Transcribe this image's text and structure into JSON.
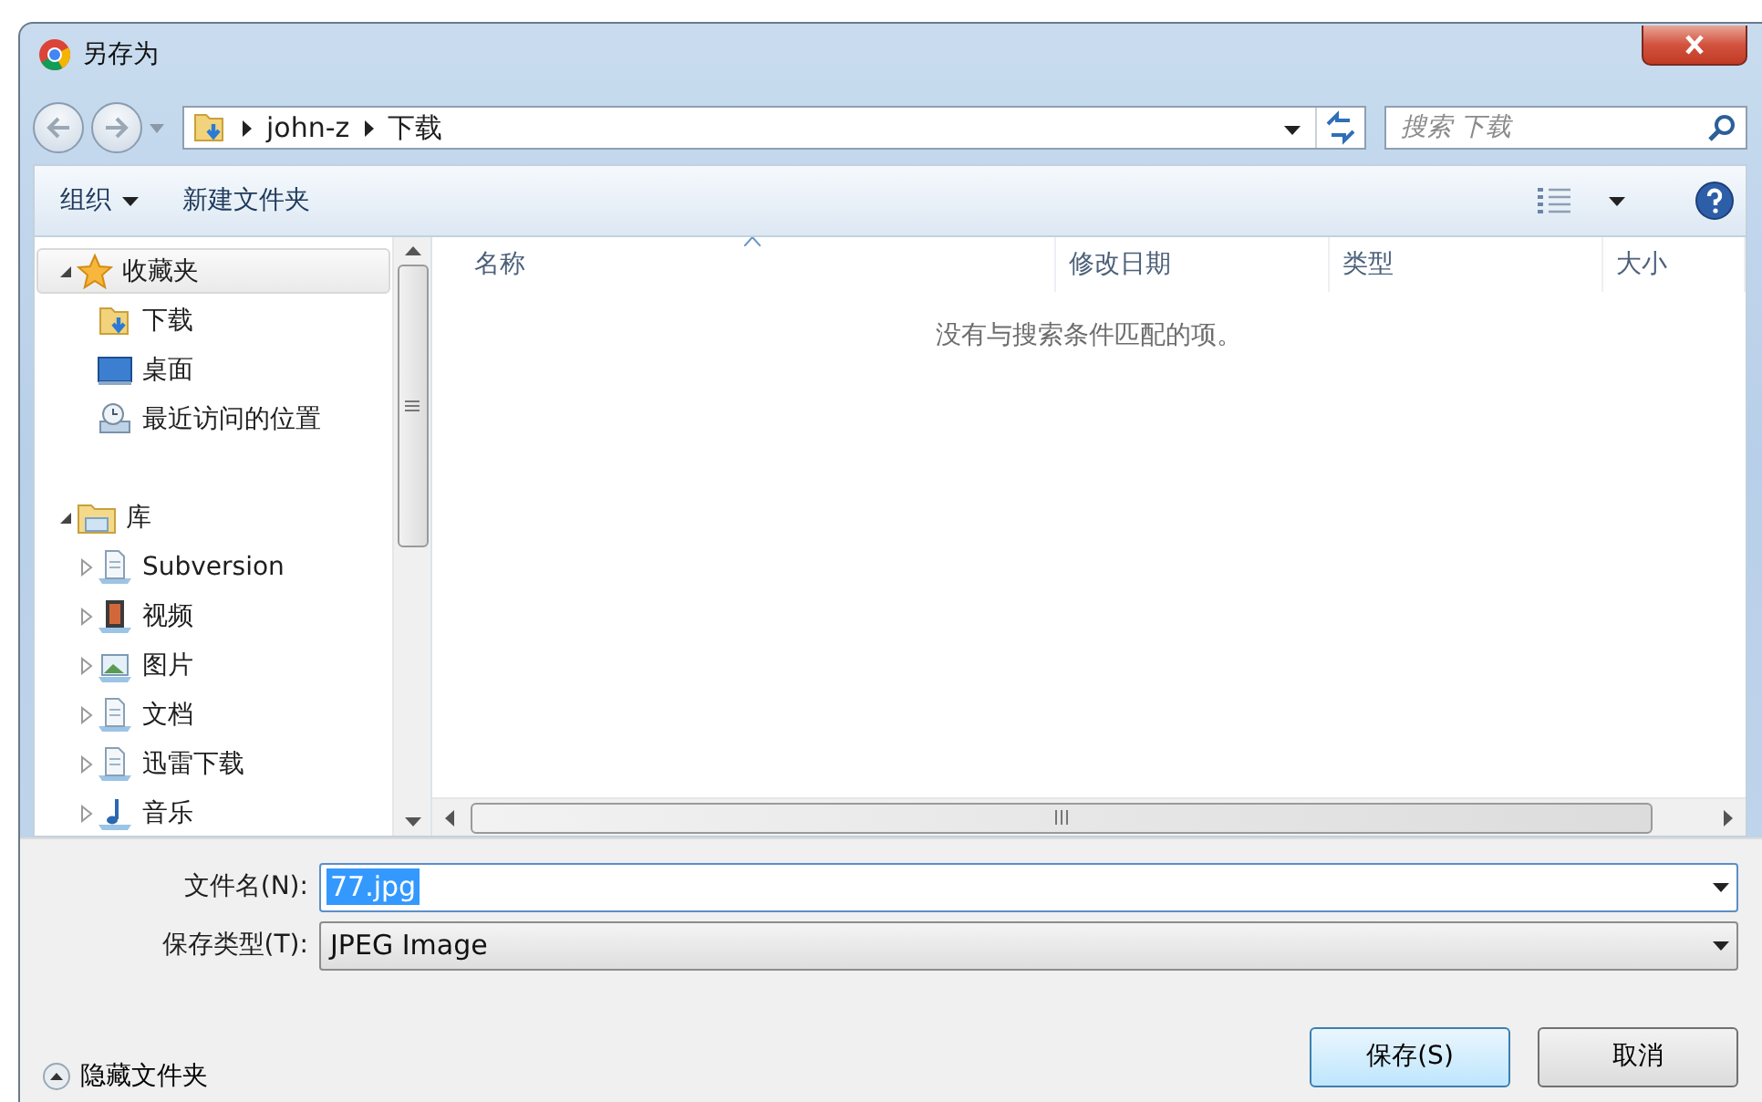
{
  "window": {
    "title": "另存为"
  },
  "address": {
    "path": [
      "john-z",
      "下载"
    ]
  },
  "search": {
    "placeholder": "搜索 下载"
  },
  "toolbar": {
    "items": [
      {
        "label": "组织",
        "dropdown": true
      },
      {
        "label": "新建文件夹",
        "dropdown": false
      }
    ]
  },
  "sidebar": {
    "items": [
      {
        "label": "收藏夹",
        "kind": "star",
        "expanded": true,
        "selected": true,
        "children": [
          {
            "label": "下载",
            "kind": "download",
            "selected": false
          },
          {
            "label": "桌面",
            "kind": "desktop",
            "selected": false
          },
          {
            "label": "最近访问的位置",
            "kind": "recent",
            "selected": false
          }
        ]
      },
      {
        "label": "库",
        "kind": "library",
        "expanded": true,
        "selected": false,
        "children": [
          {
            "label": "Subversion",
            "kind": "doclib",
            "expanded": false,
            "selected": false
          },
          {
            "label": "视频",
            "kind": "video",
            "expanded": false,
            "selected": false
          },
          {
            "label": "图片",
            "kind": "pictures",
            "expanded": false,
            "selected": false
          },
          {
            "label": "文档",
            "kind": "doclib",
            "expanded": false,
            "selected": false
          },
          {
            "label": "迅雷下载",
            "kind": "doclib",
            "expanded": false,
            "selected": false
          },
          {
            "label": "音乐",
            "kind": "music",
            "expanded": false,
            "selected": false
          }
        ]
      }
    ]
  },
  "file_list": {
    "columns": [
      {
        "label": "名称",
        "sorted": true
      },
      {
        "label": "修改日期",
        "sorted": false
      },
      {
        "label": "类型",
        "sorted": false
      },
      {
        "label": "大小",
        "sorted": false
      }
    ],
    "empty_message": "没有与搜索条件匹配的项。"
  },
  "form": {
    "fields": [
      {
        "label": "文件名(N):",
        "value": "77.jpg",
        "selected": true
      },
      {
        "label": "保存类型(T):",
        "value": "JPEG Image",
        "selected": false
      }
    ]
  },
  "hide_folders": {
    "label": "隐藏文件夹"
  },
  "buttons": [
    {
      "label": "保存(S)",
      "default": true
    },
    {
      "label": "取消",
      "default": false
    }
  ]
}
